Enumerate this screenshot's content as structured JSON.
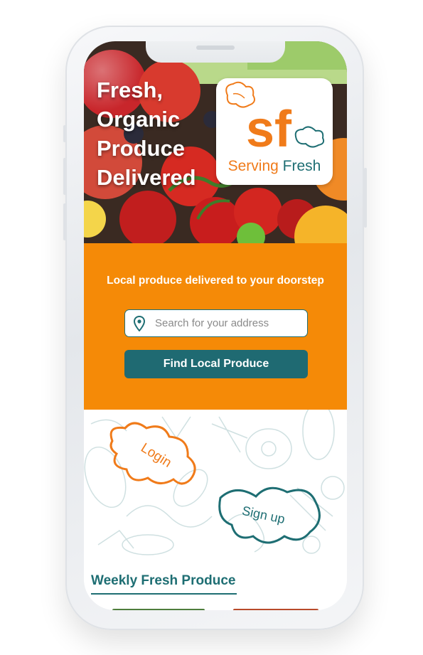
{
  "hero": {
    "title_lines": [
      "Fresh,",
      "Organic",
      "Produce",
      "Delivered"
    ]
  },
  "logo": {
    "monogram": "sf",
    "name_part1": "Serving",
    "name_part2": "Fresh"
  },
  "band": {
    "tagline": "Local produce delivered to your doorstep",
    "search": {
      "placeholder": "Search for your address",
      "value": ""
    },
    "find_button": "Find Local Produce"
  },
  "auth": {
    "login_label": "Login",
    "signup_label": "Sign up"
  },
  "weekly": {
    "title": "Weekly Fresh Produce"
  },
  "colors": {
    "brand_orange": "#f58a07",
    "brand_teal": "#1f6a72"
  },
  "icons": [
    "location-pin-icon",
    "leaf-icon"
  ]
}
